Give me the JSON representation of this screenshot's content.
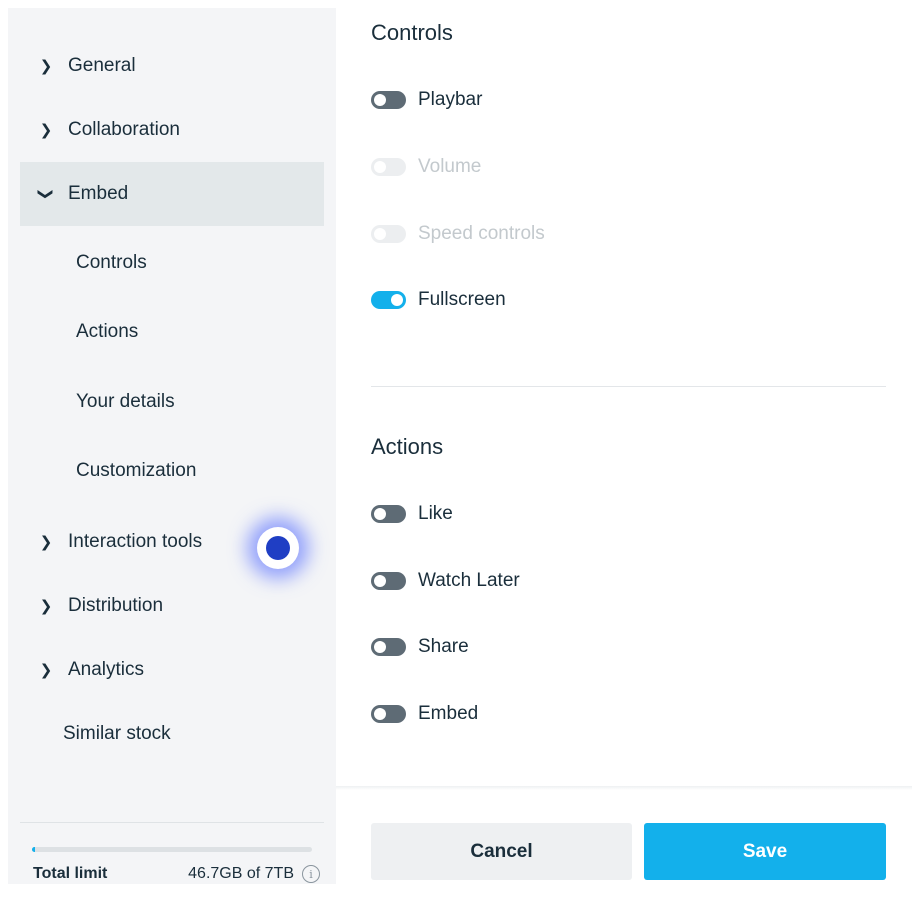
{
  "sidebar": {
    "items": [
      {
        "label": "General",
        "icon": "chevron-right-icon"
      },
      {
        "label": "Collaboration",
        "icon": "chevron-right-icon"
      },
      {
        "label": "Embed",
        "icon": "chevron-down-icon"
      },
      {
        "label": "Controls"
      },
      {
        "label": "Actions"
      },
      {
        "label": "Your details"
      },
      {
        "label": "Customization"
      },
      {
        "label": "Interaction tools",
        "icon": "chevron-right-icon"
      },
      {
        "label": "Distribution",
        "icon": "chevron-right-icon"
      },
      {
        "label": "Analytics",
        "icon": "chevron-right-icon"
      },
      {
        "label": "Similar stock"
      }
    ],
    "active_item": "Embed",
    "footer": {
      "label": "Total limit",
      "value": "46.7GB of 7TB",
      "usage_fraction": 0.0067,
      "info_icon": "info-icon"
    }
  },
  "controls": {
    "title": "Controls",
    "toggles": [
      {
        "label": "Playbar",
        "on": false,
        "disabled": false
      },
      {
        "label": "Volume",
        "on": false,
        "disabled": true
      },
      {
        "label": "Speed controls",
        "on": false,
        "disabled": true
      },
      {
        "label": "Fullscreen",
        "on": true,
        "disabled": false
      }
    ]
  },
  "actions": {
    "title": "Actions",
    "toggles": [
      {
        "label": "Like",
        "on": false,
        "disabled": false
      },
      {
        "label": "Watch Later",
        "on": false,
        "disabled": false
      },
      {
        "label": "Share",
        "on": false,
        "disabled": false
      },
      {
        "label": "Embed",
        "on": false,
        "disabled": false
      }
    ]
  },
  "buttons": {
    "cancel": "Cancel",
    "save": "Save"
  },
  "colors": {
    "accent": "#13b0eb",
    "sidebar_bg": "#f4f5f7",
    "active_bg": "#e3e8ea",
    "toggle_off": "#5e6b75",
    "text": "#1a2e3b"
  }
}
